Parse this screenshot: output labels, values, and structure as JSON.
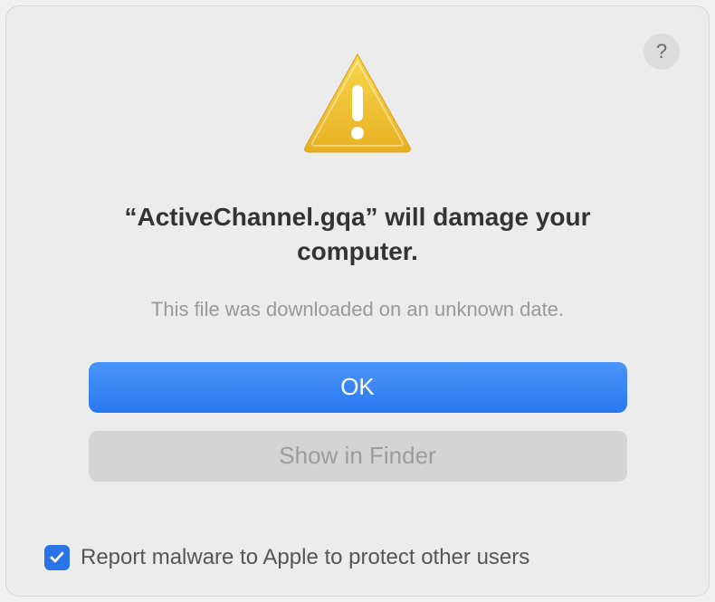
{
  "dialog": {
    "help_label": "?",
    "title_prefix": "“",
    "title_filename": "ActiveChannel.gqa",
    "title_suffix": "” will damage your computer.",
    "subtitle": "This file was downloaded on an unknown date.",
    "primary_button": "OK",
    "secondary_button": "Show in Finder",
    "checkbox_label": "Report malware to Apple to protect other users",
    "checkbox_checked": true
  },
  "icons": {
    "help": "?",
    "warning": "warning-triangle",
    "checkmark": "checkmark"
  }
}
